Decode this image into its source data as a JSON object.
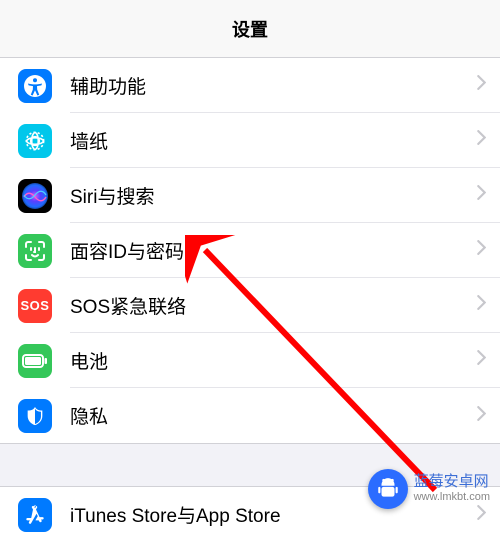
{
  "header": {
    "title": "设置"
  },
  "rows": [
    {
      "id": "accessibility",
      "label": "辅助功能"
    },
    {
      "id": "wallpaper",
      "label": "墙纸"
    },
    {
      "id": "siri",
      "label": "Siri与搜索"
    },
    {
      "id": "faceid",
      "label": "面容ID与密码"
    },
    {
      "id": "sos",
      "label": "SOS紧急联络",
      "icon_text": "SOS"
    },
    {
      "id": "battery",
      "label": "电池"
    },
    {
      "id": "privacy",
      "label": "隐私"
    }
  ],
  "rows2": [
    {
      "id": "itunes",
      "label": "iTunes Store与App Store"
    }
  ],
  "watermark": {
    "brand": "蓝莓安卓网",
    "url": "www.lmkbt.com"
  }
}
